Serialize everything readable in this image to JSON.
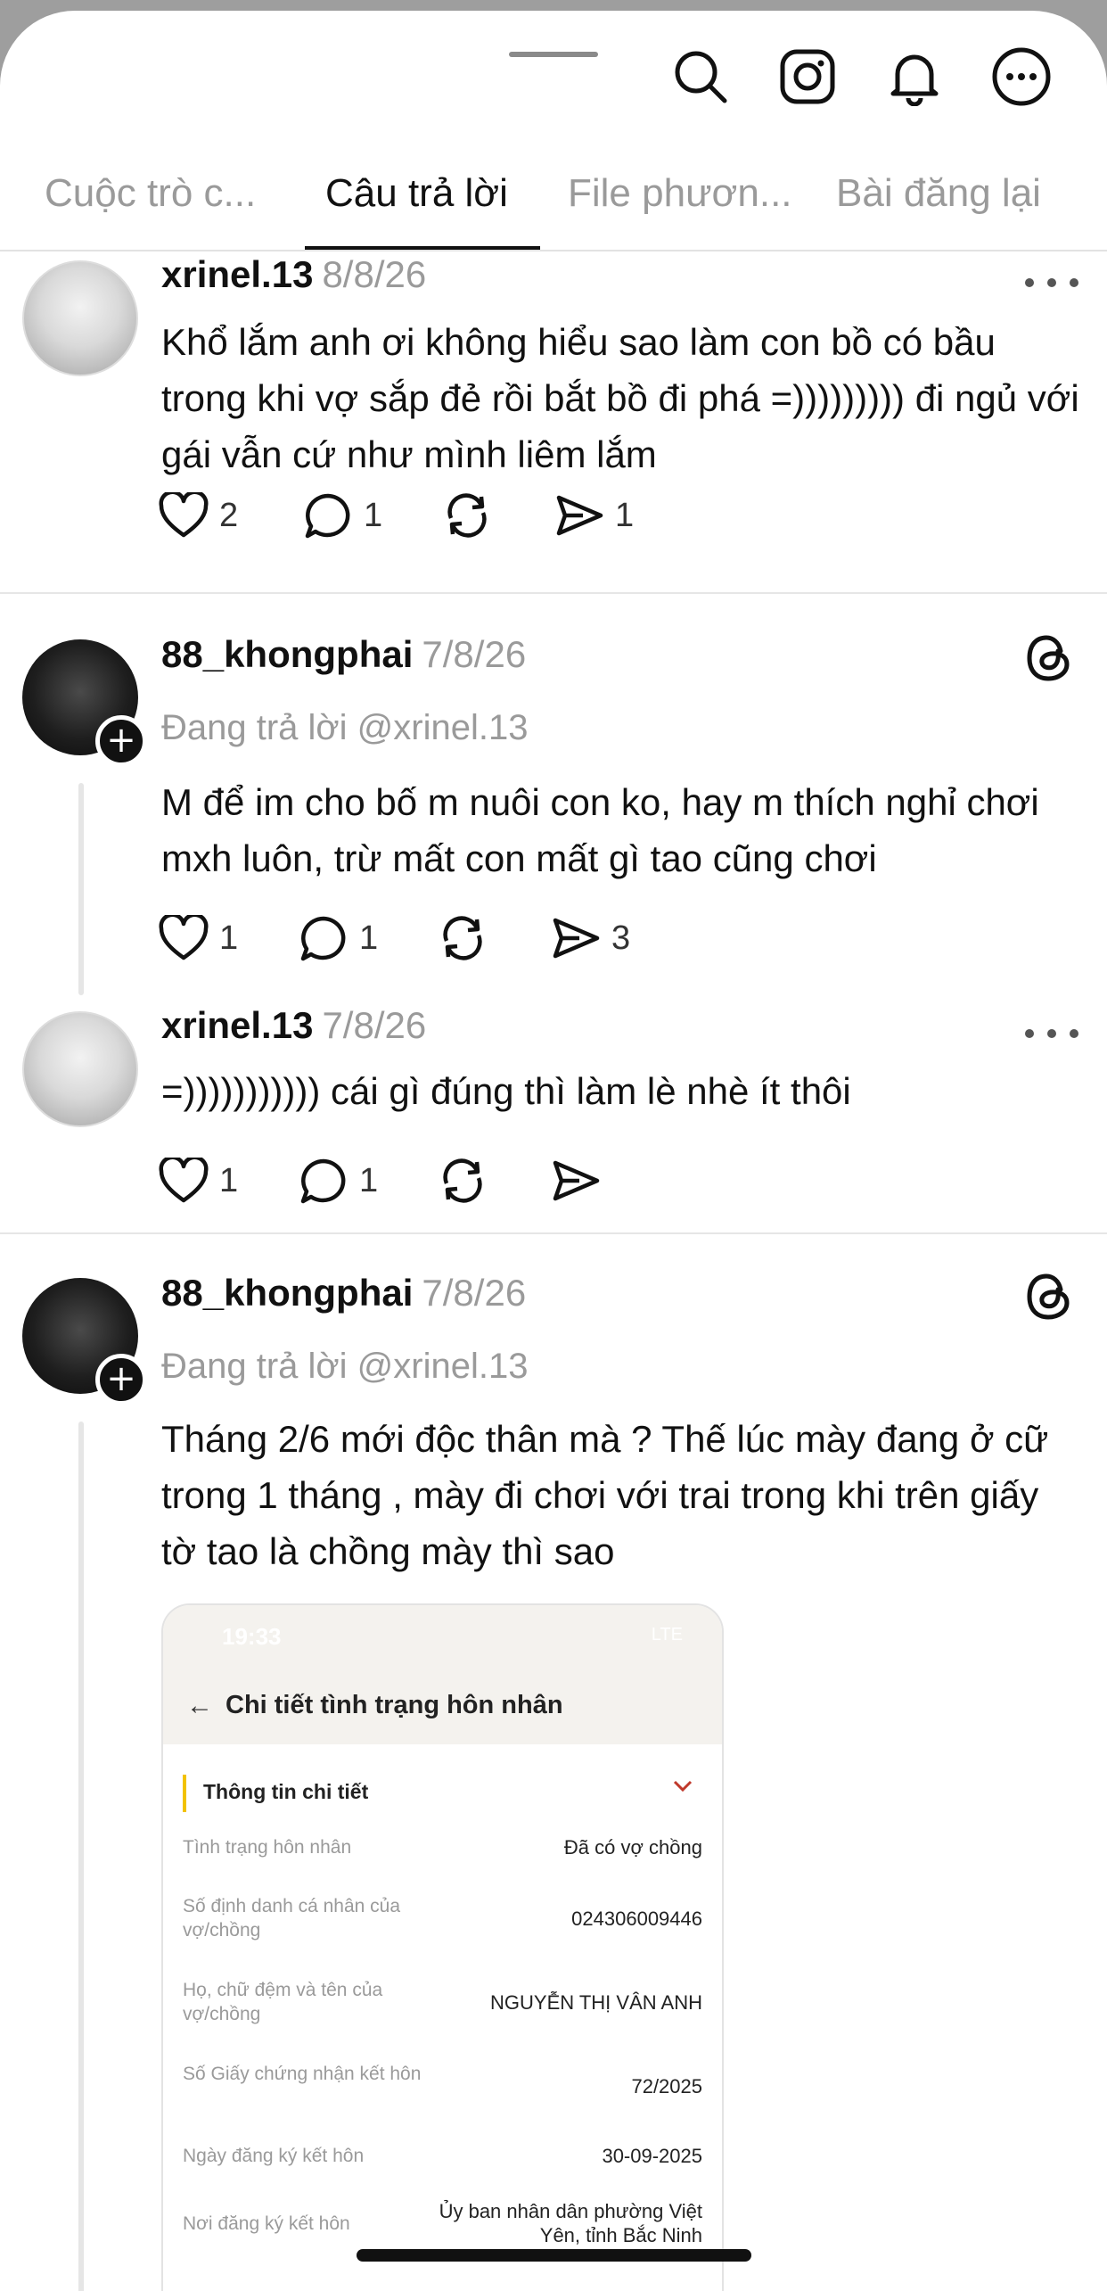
{
  "tabs": [
    {
      "label": "Cuộc trò c...",
      "active": false
    },
    {
      "label": "Câu trả lời",
      "active": true
    },
    {
      "label": "File phươn...",
      "active": false
    },
    {
      "label": "Bài đăng lại",
      "active": false
    }
  ],
  "icons": {
    "search": "search-icon",
    "instagram": "instagram-icon",
    "notifications": "bell-icon",
    "more": "more-icon"
  },
  "posts": [
    {
      "username": "xrinel.13",
      "date": "8/8/26",
      "text": "Khổ lắm anh ơi không hiểu sao làm con bồ có bầu trong khi vợ sắp đẻ rồi bắt bồ đi phá =))))))))) đi ngủ với gái vẫn cứ như mình liêm lắm",
      "likes": "2",
      "comments": "1",
      "reposts": "",
      "shares": "1"
    },
    {
      "username": "88_khongphai",
      "date": "7/8/26",
      "replying_to": "Đang trả lời @xrinel.13",
      "text": "M để im cho bố m nuôi con ko, hay m thích nghỉ chơi mxh luôn, trừ mất con mất gì tao cũng chơi",
      "likes": "1",
      "comments": "1",
      "reposts": "",
      "shares": "3"
    },
    {
      "username": "xrinel.13",
      "date": "7/8/26",
      "text": "=))))))))))) cái gì đúng thì làm lè nhè ít thôi",
      "likes": "1",
      "comments": "1",
      "reposts": "",
      "shares": ""
    },
    {
      "username": "88_khongphai",
      "date": "7/8/26",
      "replying_to": "Đang trả lời @xrinel.13",
      "text": "Tháng 2/6 mới độc thân mà ? Thế lúc mày đang ở cữ trong 1 tháng , mày đi chơi với trai trong khi trên giấy tờ tao là chồng mày thì sao",
      "likes": "",
      "comments": "",
      "reposts": "",
      "shares": ""
    }
  ],
  "attachment": {
    "status_time": "19:33",
    "status_net": "LTE",
    "title": "Chi tiết tình trạng hôn nhân",
    "section": "Thông tin chi tiết",
    "rows": [
      {
        "key": "Tình trạng hôn nhân",
        "value": "Đã có vợ chồng"
      },
      {
        "key": "Số định danh cá nhân của vợ/chồng",
        "value": "024306009446"
      },
      {
        "key": "Họ, chữ đệm và tên của vợ/chồng",
        "value": "NGUYỄN THỊ VÂN ANH"
      },
      {
        "key": "Số Giấy chứng nhận kết hôn",
        "value": "72/2025"
      },
      {
        "key": "Ngày đăng ký kết hôn",
        "value": "30-09-2025"
      },
      {
        "key": "Nơi đăng ký kết hôn",
        "value": "Ủy ban nhân dân phường Việt Yên, tỉnh Bắc Ninh"
      }
    ]
  }
}
